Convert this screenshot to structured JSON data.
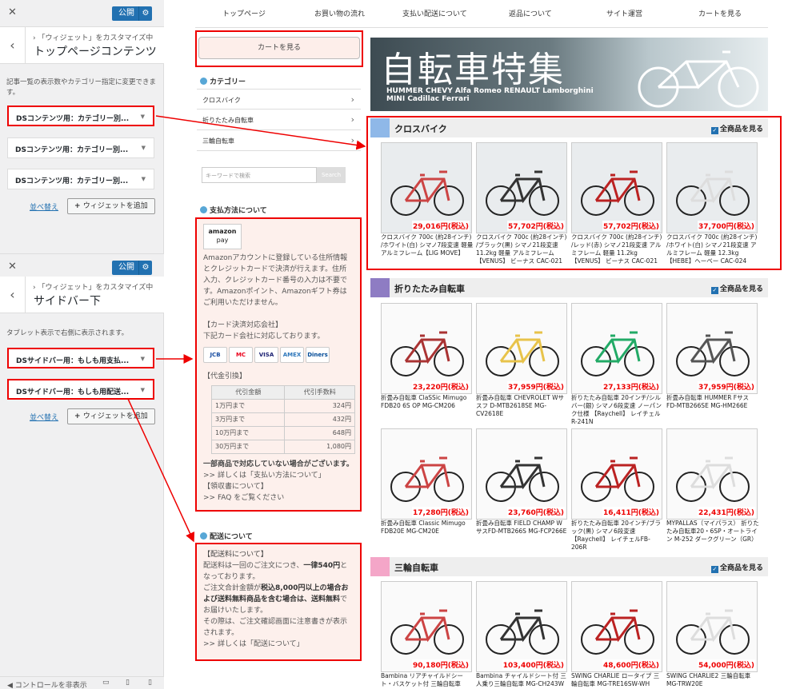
{
  "customizer": {
    "close": "✕",
    "publish": "公開",
    "panel1": {
      "crumb": "「ウィジェット」をカスタマイズ中",
      "title": "トップページコンテンツ",
      "desc": "記事一覧の表示数やカテゴリー指定に変更できます。",
      "widgets": [
        "DSコンテンツ用：カテゴリー別...",
        "DSコンテンツ用：カテゴリー別...",
        "DSコンテンツ用：カテゴリー別..."
      ],
      "reorder": "並べ替え",
      "add": "ウィジェットを追加"
    },
    "panel2": {
      "crumb": "「ウィジェット」をカスタマイズ中",
      "title": "サイドバー下",
      "desc": "タブレット表示で右側に表示されます。",
      "widgets": [
        "DSサイドバー用：もしも用支払...",
        "DSサイドバー用：もしも用配送..."
      ],
      "reorder": "並べ替え",
      "add": "ウィジェットを追加"
    },
    "footer": "コントロールを非表示"
  },
  "nav": [
    "トップページ",
    "お買い物の流れ",
    "支払い配送について",
    "返品について",
    "サイト運営",
    "カートを見る"
  ],
  "sidebar": {
    "cart_button": "カートを見る",
    "category_heading": "カテゴリー",
    "categories": [
      "クロスバイク",
      "折りたたみ自転車",
      "三輪自転車"
    ],
    "search_placeholder": "キーワードで検索",
    "search_button": "Search",
    "payment_heading": "支払方法について",
    "amazon_top": "amazon",
    "amazon_bottom": "pay",
    "amazon_text": "Amazonアカウントに登録している住所情報とクレジットカードで決済が行えます。住所入力、クレジットカード番号の入力は不要です。Amazonポイント、Amazonギフト券はご利用いただけません。",
    "card_heading": "【カード決済対応会社】",
    "card_text": "下記カード会社に対応しております。",
    "card_logos": [
      "JCB",
      "MC",
      "VISA",
      "AMEX",
      "Diners"
    ],
    "cod_heading": "【代金引換】",
    "cod_cols": [
      "代引金額",
      "代引手数料"
    ],
    "cod_rows": [
      [
        "1万円まで",
        "324円"
      ],
      [
        "3万円まで",
        "432円"
      ],
      [
        "10万円まで",
        "648円"
      ],
      [
        "30万円まで",
        "1,080円"
      ]
    ],
    "pay_notes": [
      "一部商品で対応していない場合がございます。",
      ">> 詳しくは「支払い方法について」",
      "【領収書について】",
      ">> FAQ をご覧ください"
    ],
    "delivery_heading": "配送について",
    "delivery_title": "【配送料について】",
    "delivery_lines": [
      "配送料は一回のご注文につき、",
      "一律540円",
      "となっております。",
      "ご注文合計金額が",
      "税込8,000円以上の場合および送料無料商品を含む場合は、送料無料",
      "でお届けいたします。",
      "その際は、ご注文確認画面に注意書きが表示されます。",
      ">> 詳しくは「配送について」"
    ]
  },
  "banner": {
    "title": "自転車特集",
    "brands": "HUMMER  CHEVY  Alfa Romeo  RENAULT  Lamborghini  MINI  Cadillac  Ferrari"
  },
  "sections": [
    {
      "name": "クロスバイク",
      "color": "#8fb8e8",
      "all": "全商品を見る",
      "products": [
        {
          "price": "29,016円(税込)",
          "name": "クロスバイク 700c (約28インチ) /ホワイト(白) シマノ7段変速 軽量 アルミフレーム【LIG MOVE】"
        },
        {
          "price": "57,702円(税込)",
          "name": "クロスバイク 700c (約28インチ) /ブラック(黒) シマノ21段変速 11.2kg 軽量 アルミフレーム【VENUS】 ビーナス CAC-021"
        },
        {
          "price": "57,702円(税込)",
          "name": "クロスバイク 700c (約28インチ) /レッド(赤) シマノ21段変速 アルミフレーム 軽量 11.2kg【VENUS】 ビーナス CAC-021"
        },
        {
          "price": "37,700円(税込)",
          "name": "クロスバイク 700c (約28インチ) /ホワイト(白) シマノ21段変速 アルミフレーム 軽量 12.3kg【HEBE】ヘーベー CAC-024"
        }
      ]
    },
    {
      "name": "折りたたみ自転車",
      "color": "#8e7cc3",
      "all": "全商品を見る",
      "products": [
        {
          "price": "23,220円(税込)",
          "name": "折畳み自転車 ClaSSic Mimugo FDB20 6S OP MG-CM206"
        },
        {
          "price": "37,959円(税込)",
          "name": "折畳み自転車 CHEVROLET Wサスフ D-MTB2618SE MG-CV2618E"
        },
        {
          "price": "27,133円(税込)",
          "name": "折りたたみ自転車 20インチ/シルバー(銀) シマノ6段変速 ノーパンク仕様 【Raychell】 レイチェル R-241N"
        },
        {
          "price": "37,959円(税込)",
          "name": "折畳み自転車 HUMMER Fサス FD-MTB266SE MG-HM266E"
        },
        {
          "price": "17,280円(税込)",
          "name": "折畳み自転車 Classic Mimugo FDB20E MG-CM20E"
        },
        {
          "price": "23,760円(税込)",
          "name": "折畳み自転車 FIELD CHAMP W サスFD-MTB266S MG-FCP266E"
        },
        {
          "price": "16,411円(税込)",
          "name": "折りたたみ自転車 20インチ/ブラック(黒) シマノ6段変速 【Raychell】 レイチェルFB-206R"
        },
        {
          "price": "22,431円(税込)",
          "name": "MYPALLAS（マイパラス） 折りたたみ自転車20・6SP・オートライン M-252 ダークグリーン（GR）"
        }
      ]
    },
    {
      "name": "三輪自転車",
      "color": "#f4a6c8",
      "all": "全商品を見る",
      "products": [
        {
          "price": "90,180円(税込)",
          "name": "Bambina リアチャイルドシート・バスケット付 三輪自転車 MG-CH243RB"
        },
        {
          "price": "103,400円(税込)",
          "name": "Bambina チャイルドシート付 三人乗り三輪自転車 MG-CH243W"
        },
        {
          "price": "48,600円(税込)",
          "name": "SWING CHARLIE ロータイプ 三輪自転車 MG-TRE16SW-WH"
        },
        {
          "price": "54,000円(税込)",
          "name": "SWING CHARLIE2 三輪自転車 MG-TRW20E"
        }
      ]
    }
  ]
}
